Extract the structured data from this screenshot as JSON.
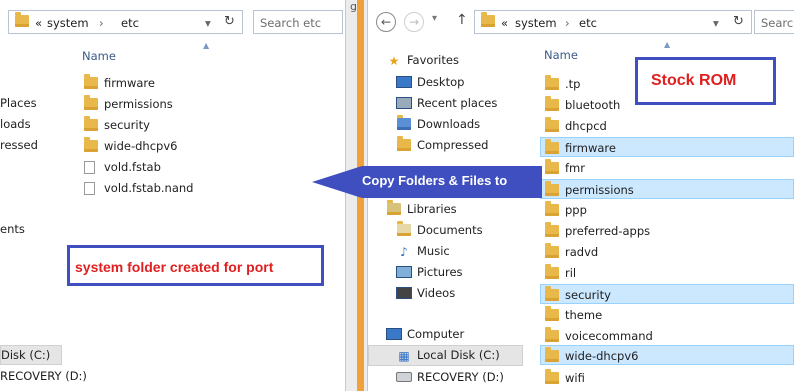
{
  "left_window": {
    "address": {
      "chevron": "«",
      "crumbs": [
        "system",
        "etc"
      ],
      "separator": "›",
      "dropdown": "▾",
      "refresh": "↻"
    },
    "search_placeholder": "Search etc",
    "column_name": "Name",
    "nav_fragments": [
      "Places",
      "loads",
      "ressed",
      "ents",
      "Disk (C:)",
      "RECOVERY (D:)"
    ],
    "files": [
      {
        "name": "firmware",
        "type": "folder"
      },
      {
        "name": "permissions",
        "type": "folder"
      },
      {
        "name": "security",
        "type": "folder"
      },
      {
        "name": "wide-dhcpv6",
        "type": "folder"
      },
      {
        "name": "vold.fstab",
        "type": "file"
      },
      {
        "name": "vold.fstab.nand",
        "type": "file"
      }
    ]
  },
  "gap_mark": "g",
  "right_window": {
    "nav_buttons": {
      "back": "←",
      "forward": "→",
      "up": "↑"
    },
    "address": {
      "chevron": "«",
      "crumbs": [
        "system",
        "etc"
      ],
      "separator": "›",
      "dropdown": "▾",
      "refresh": "↻"
    },
    "search_placeholder": "Search",
    "column_name": "Name",
    "nav": [
      {
        "label": "Favorites",
        "icon": "star-icon"
      },
      {
        "label": "Desktop",
        "icon": "desktop-icon"
      },
      {
        "label": "Recent places",
        "icon": "recent-places-icon"
      },
      {
        "label": "Downloads",
        "icon": "downloads-icon"
      },
      {
        "label": "Compressed",
        "icon": "folder-icon"
      },
      {
        "label": "Libraries",
        "icon": "libraries-icon"
      },
      {
        "label": "Documents",
        "icon": "documents-icon"
      },
      {
        "label": "Music",
        "icon": "music-icon"
      },
      {
        "label": "Pictures",
        "icon": "pictures-icon"
      },
      {
        "label": "Videos",
        "icon": "videos-icon"
      },
      {
        "label": "Computer",
        "icon": "computer-icon"
      },
      {
        "label": "Local Disk (C:)",
        "icon": "windows-drive-icon"
      },
      {
        "label": "RECOVERY (D:)",
        "icon": "drive-icon"
      }
    ],
    "files": [
      {
        "name": ".tp",
        "selected": false
      },
      {
        "name": "bluetooth",
        "selected": false
      },
      {
        "name": "dhcpcd",
        "selected": false
      },
      {
        "name": "firmware",
        "selected": true
      },
      {
        "name": "fmr",
        "selected": false
      },
      {
        "name": "permissions",
        "selected": true
      },
      {
        "name": "ppp",
        "selected": false
      },
      {
        "name": "preferred-apps",
        "selected": false
      },
      {
        "name": "radvd",
        "selected": false
      },
      {
        "name": "ril",
        "selected": false
      },
      {
        "name": "security",
        "selected": true
      },
      {
        "name": "theme",
        "selected": false
      },
      {
        "name": "voicecommand",
        "selected": false
      },
      {
        "name": "wide-dhcpv6",
        "selected": true
      },
      {
        "name": "wifi",
        "selected": false
      }
    ]
  },
  "annotations": {
    "stock_rom": "Stock ROM",
    "copy_arrow": "Copy Folders & Files to",
    "port_label": "system folder created for port"
  },
  "colors": {
    "annotation_border": "#3f4fbf",
    "annotation_text": "#e02020",
    "arrow": "#3f4fbf",
    "selection": "#cce8ff"
  }
}
